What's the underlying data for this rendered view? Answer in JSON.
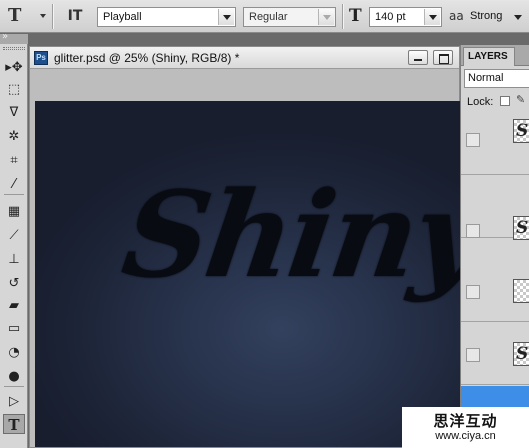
{
  "options_bar": {
    "tool_icon": "T",
    "orientation_icon": "IT",
    "font_family": "Playball",
    "font_style": "Regular",
    "size_icon": "T",
    "font_size": "140 pt",
    "antialias_icon": "aa",
    "antialias": "Strong"
  },
  "toolbox": {
    "tools": [
      {
        "name": "move-tool",
        "glyph": "▸✥"
      },
      {
        "name": "marquee-tool",
        "glyph": "⬚"
      },
      {
        "name": "lasso-tool",
        "glyph": "ᐁ"
      },
      {
        "name": "quick-selection-tool",
        "glyph": "✲"
      },
      {
        "name": "crop-tool",
        "glyph": "⌗"
      },
      {
        "name": "eyedropper-tool",
        "glyph": "⁄"
      },
      {
        "name": "healing-brush-tool",
        "glyph": "▦"
      },
      {
        "name": "brush-tool",
        "glyph": "⟋"
      },
      {
        "name": "clone-stamp-tool",
        "glyph": "⊥"
      },
      {
        "name": "history-brush-tool",
        "glyph": "↺"
      },
      {
        "name": "eraser-tool",
        "glyph": "▰"
      },
      {
        "name": "gradient-tool",
        "glyph": "▭"
      },
      {
        "name": "blur-tool",
        "glyph": "◔"
      },
      {
        "name": "dodge-tool",
        "glyph": "●"
      },
      {
        "name": "path-selection-tool",
        "glyph": "▷"
      },
      {
        "name": "type-tool",
        "glyph": "T"
      }
    ],
    "active_tool": "type-tool"
  },
  "document": {
    "badge": "Ps",
    "title": "glitter.psd @ 25% (Shiny, RGB/8) *",
    "canvas_text": "Shiny"
  },
  "layers_panel": {
    "tab": "LAYERS",
    "blend_mode": "Normal",
    "lock_label": "Lock:",
    "layer_thumb_glyph": "S"
  },
  "watermark": {
    "chinese": "思洋互动",
    "url": "www.ciya.cn"
  },
  "colors": {
    "canvas_dark": "#181e2e",
    "canvas_glow": "#33415e",
    "text_fill": "#090b12",
    "selected_layer": "#3d8ee6"
  }
}
